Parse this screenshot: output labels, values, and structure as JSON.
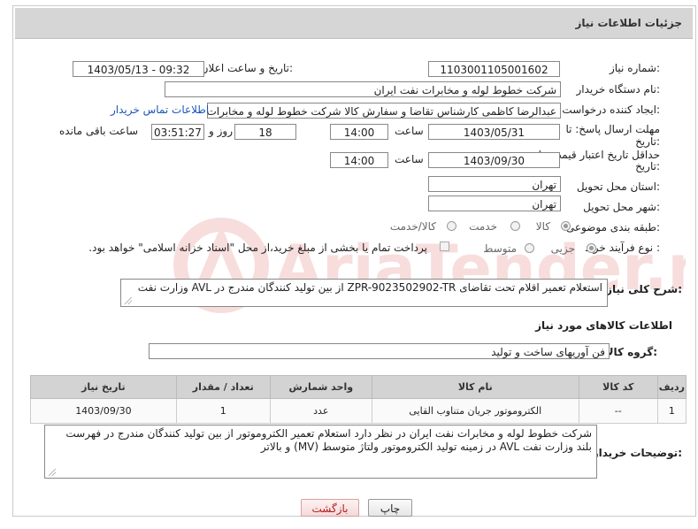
{
  "header": {
    "title": "جزئیات اطلاعات نیاز"
  },
  "fields": {
    "need_number": {
      "label": "شماره نیاز:",
      "value": "1103001105001602"
    },
    "announce_datetime": {
      "label": "تاریخ و ساعت اعلان عمومی:",
      "value": "1403/05/13 - 09:32"
    },
    "buyer_org": {
      "label": "نام دستگاه خریدار:",
      "value": "شرکت خطوط لوله و مخابرات نفت ایران"
    },
    "requester": {
      "label": "ایجاد کننده درخواست:",
      "value": "عبدالرضا کاظمی کارشناس تقاضا و سفارش کالا شرکت خطوط لوله و مخابرات نفت ایران",
      "contact_link": "اطلاعات تماس خریدار"
    },
    "reply_deadline": {
      "label_line1": "مهلت ارسال پاسخ: تا",
      "label_line2": "تاریخ:",
      "date": "1403/05/31",
      "time_label": "ساعت",
      "time": "14:00",
      "days": "18",
      "days_label": "روز و",
      "remaining": "03:51:27",
      "remaining_label": "ساعت باقی مانده"
    },
    "price_validity": {
      "label_line1": "حداقل تاریخ اعتبار قیمت: تا",
      "label_line2": "تاریخ:",
      "date": "1403/09/30",
      "time_label": "ساعت",
      "time": "14:00"
    },
    "delivery_province": {
      "label": "استان محل تحویل:",
      "value": "تهران"
    },
    "delivery_city": {
      "label": "شهر محل تحویل:",
      "value": "تهران"
    },
    "category": {
      "label": "طبقه بندی موضوعی:",
      "options": [
        "کالا",
        "خدمت",
        "کالا/خدمت"
      ],
      "selected": "کالا"
    },
    "purchase_process": {
      "label": "نوع فرآیند خرید :",
      "options": [
        "جزیی",
        "متوسط"
      ],
      "selected": "جزیی",
      "payment_note": "پرداخت تمام یا بخشی از مبلغ خرید،از محل \"اسناد خزانه اسلامی\" خواهد بود."
    }
  },
  "need_description": {
    "label": "شرح کلی نیاز:",
    "value": "استعلام تعمیر اقلام تحت تقاضای ZPR-9023502902-TR از بین تولید کنندگان مندرج در AVL وزارت نفت"
  },
  "goods_info": {
    "section_title": "اطلاعات کالاهای مورد نیاز",
    "group_label": "گروه کالا:",
    "group_value": "فن آوریهای ساخت و تولید",
    "table": {
      "headers": [
        "ردیف",
        "کد کالا",
        "نام کالا",
        "واحد شمارش",
        "تعداد / مقدار",
        "تاریخ نیاز"
      ],
      "rows": [
        {
          "row": "1",
          "code": "--",
          "name": "الکتروموتور جریان متناوب القایی",
          "unit": "عدد",
          "qty": "1",
          "date": "1403/09/30"
        }
      ]
    }
  },
  "buyer_notes": {
    "label": "توضیحات خریدار:",
    "value": "شرکت خطوط لوله و مخابرات نفت ایران در نظر دارد استعلام تعمیر الکتروموتور از بین تولید کنندگان مندرج در فهرست بلند وزارت نفت AVL در زمینه تولید الکتروموتور ولتاژ متوسط (MV) و بالاتر"
  },
  "buttons": {
    "print": "چاپ",
    "back": "بازگشت"
  },
  "watermark": {
    "text": "AriaTender.neT"
  },
  "colors": {
    "header_bg": "#d6d6d6",
    "link": "#1a55b8",
    "back_button_text": "#b02020"
  }
}
